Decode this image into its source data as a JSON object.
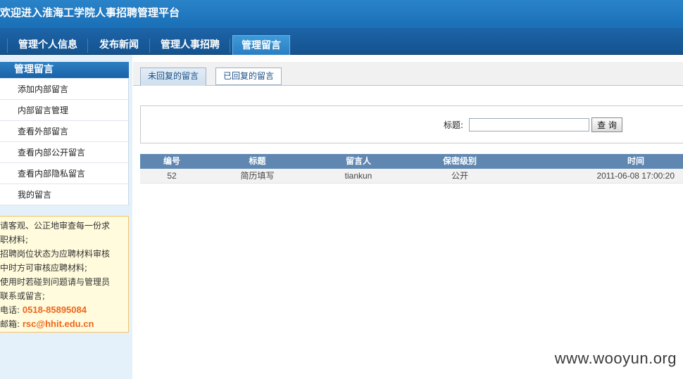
{
  "header": {
    "title": "欢迎进入淮海工学院人事招聘管理平台"
  },
  "nav": [
    {
      "label": "管理个人信息"
    },
    {
      "label": "发布新闻"
    },
    {
      "label": "管理人事招聘"
    },
    {
      "label": "管理留言"
    }
  ],
  "sidebar": {
    "title": "管理留言",
    "items": [
      {
        "label": "添加内部留言"
      },
      {
        "label": "内部留言管理"
      },
      {
        "label": "查看外部留言"
      },
      {
        "label": "查看内部公开留言"
      },
      {
        "label": "查看内部隐私留言"
      },
      {
        "label": "我的留言"
      }
    ],
    "notice": {
      "lines": [
        "请客观、公正地审查每一份求",
        "职材料;",
        "招聘岗位状态为应聘材料审核",
        "中时方可审核应聘材料;",
        "使用时若碰到问题请与管理员",
        "联系或留言;"
      ],
      "phone_label": "电话:",
      "phone": "0518-85895084",
      "email_label": "邮箱:",
      "email": "rsc@hhit.edu.cn"
    }
  },
  "tabs": [
    {
      "label": "未回复的留言"
    },
    {
      "label": "已回复的留言"
    }
  ],
  "search": {
    "label": "标题:",
    "value": "",
    "button": "查 询"
  },
  "table": {
    "headers": [
      "编号",
      "标题",
      "留言人",
      "保密级别",
      "时间"
    ],
    "rows": [
      [
        "52",
        "简历填写",
        "tiankun",
        "公开",
        "2011-06-08 17:00:20"
      ]
    ]
  },
  "watermark": "www.wooyun.org"
}
